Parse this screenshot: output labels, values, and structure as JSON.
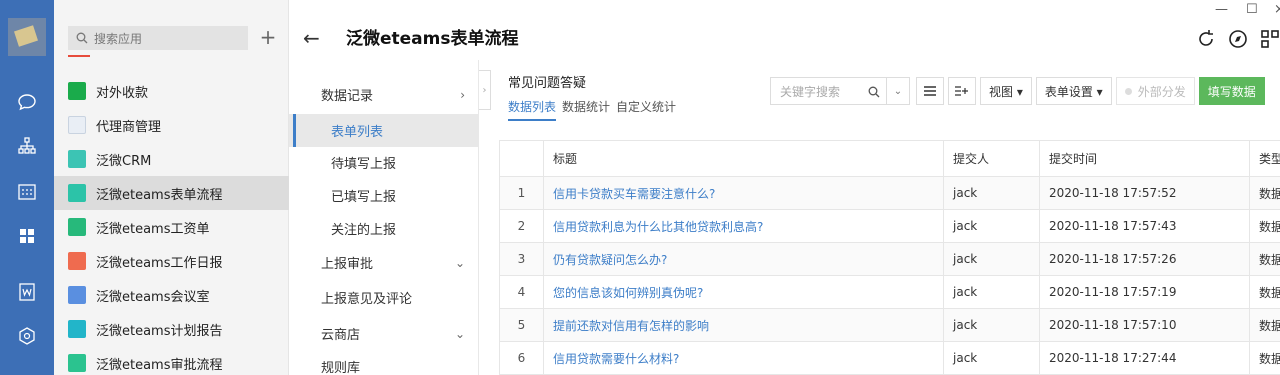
{
  "search": {
    "placeholder": "搜索应用"
  },
  "apps": [
    {
      "label": "对外收款",
      "color": "#1aab4b",
      "icon": "shield-icon"
    },
    {
      "label": "代理商管理",
      "color": "#e9eef5",
      "icon": "document-icon"
    },
    {
      "label": "泛微CRM",
      "color": "#3cc4b4",
      "icon": "crm-icon"
    },
    {
      "label": "泛微eteams表单流程",
      "color": "#2cc3a8",
      "icon": "form-flow-icon"
    },
    {
      "label": "泛微eteams工资单",
      "color": "#27b97b",
      "icon": "payroll-icon"
    },
    {
      "label": "泛微eteams工作日报",
      "color": "#ef6b4f",
      "icon": "daily-report-icon"
    },
    {
      "label": "泛微eteams会议室",
      "color": "#5a8fe0",
      "icon": "meeting-room-icon"
    },
    {
      "label": "泛微eteams计划报告",
      "color": "#22b5c9",
      "icon": "plan-report-icon"
    },
    {
      "label": "泛微eteams审批流程",
      "color": "#2bc38f",
      "icon": "approval-icon"
    }
  ],
  "header": {
    "title": "泛微eteams表单流程"
  },
  "submenu": [
    {
      "label": "数据记录",
      "chev": "›"
    },
    {
      "label": "表单列表",
      "sub": true,
      "active": true
    },
    {
      "label": "待填写上报",
      "sub": true
    },
    {
      "label": "已填写上报",
      "sub": true
    },
    {
      "label": "关注的上报",
      "sub": true
    },
    {
      "label": "上报审批",
      "chev": "⌄"
    },
    {
      "label": "上报意见及评论"
    },
    {
      "label": "云商店",
      "chev": "⌄"
    },
    {
      "label": "规则库"
    }
  ],
  "content": {
    "title": "常见问题答疑",
    "tabs": [
      "数据列表",
      "数据统计",
      "自定义统计"
    ],
    "keyword_placeholder": "关键字搜索",
    "buttons": {
      "view": "视图 ▾",
      "form_settings": "表单设置 ▾",
      "external": "外部分发",
      "fill": "填写数据"
    }
  },
  "table": {
    "columns": [
      "",
      "标题",
      "提交人",
      "提交时间",
      "类型"
    ],
    "rows": [
      [
        "1",
        "信用卡贷款买车需要注意什么?",
        "jack",
        "2020-11-18 17:57:52",
        "数据"
      ],
      [
        "2",
        "信用贷款利息为什么比其他贷款利息高?",
        "jack",
        "2020-11-18 17:57:43",
        "数据"
      ],
      [
        "3",
        "仍有贷款疑问怎么办?",
        "jack",
        "2020-11-18 17:57:26",
        "数据"
      ],
      [
        "4",
        "您的信息该如何辨别真伪呢?",
        "jack",
        "2020-11-18 17:57:19",
        "数据"
      ],
      [
        "5",
        "提前还款对信用有怎样的影响",
        "jack",
        "2020-11-18 17:57:10",
        "数据"
      ],
      [
        "6",
        "信用贷款需要什么材料?",
        "jack",
        "2020-11-18 17:27:44",
        "数据"
      ]
    ]
  }
}
